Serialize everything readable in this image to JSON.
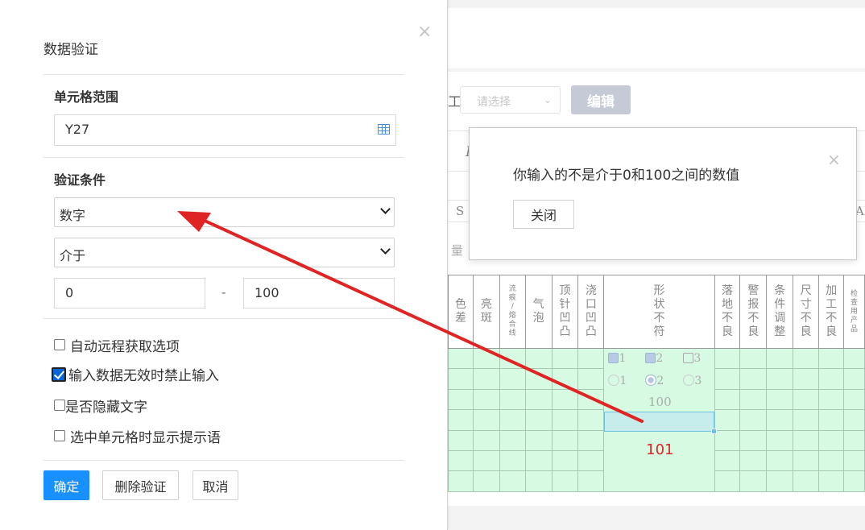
{
  "background": {
    "toolbar_glyph": "工",
    "select_placeholder": "请选择",
    "edit_button": "编辑",
    "col_letter_row": [
      "S",
      "AB"
    ],
    "italic_letter": "I",
    "fragment": "量",
    "headers": [
      {
        "text": "色差",
        "small": false
      },
      {
        "text": "亮斑",
        "small": false
      },
      {
        "text": "流痕/熔合线",
        "small": true
      },
      {
        "text": "气泡",
        "small": false
      },
      {
        "text": "顶针凹凸",
        "small": false
      },
      {
        "text": "浇口凹凸",
        "small": false
      },
      {
        "text": "形状不符",
        "small": false
      },
      {
        "text": "落地不良",
        "small": false
      },
      {
        "text": "警报不良",
        "small": false
      },
      {
        "text": "条件调整",
        "small": false
      },
      {
        "text": "尺寸不良",
        "small": false
      },
      {
        "text": "加工不良",
        "small": false
      },
      {
        "text": "检查用产品",
        "small": true
      }
    ],
    "checkbox_labels": [
      "1",
      "2",
      "3"
    ],
    "radio_labels": [
      "1",
      "2",
      "3"
    ],
    "cell_value_100": "100",
    "cell_value_101": "101"
  },
  "panel": {
    "title": "数据验证",
    "range_section": "单元格范围",
    "range_value": "Y27",
    "condition_section": "验证条件",
    "type_select": "数字",
    "operator_select": "介于",
    "min_value": "0",
    "dash": "-",
    "max_value": "100",
    "options": [
      {
        "label": "自动远程获取选项",
        "checked": false
      },
      {
        "label": "输入数据无效时禁止输入",
        "checked": true
      },
      {
        "label": "是否隐藏文字",
        "checked": false
      },
      {
        "label": "选中单元格时显示提示语",
        "checked": false
      }
    ],
    "ok_button": "确定",
    "delete_button": "删除验证",
    "cancel_button": "取消"
  },
  "alert": {
    "message": "你输入的不是介于0和100之间的数值",
    "close_button": "关闭"
  },
  "colors": {
    "primary": "#1890ff",
    "grid_fill": "#d6fae2",
    "arrow": "#e02323",
    "invalid_value": "#e02323"
  }
}
